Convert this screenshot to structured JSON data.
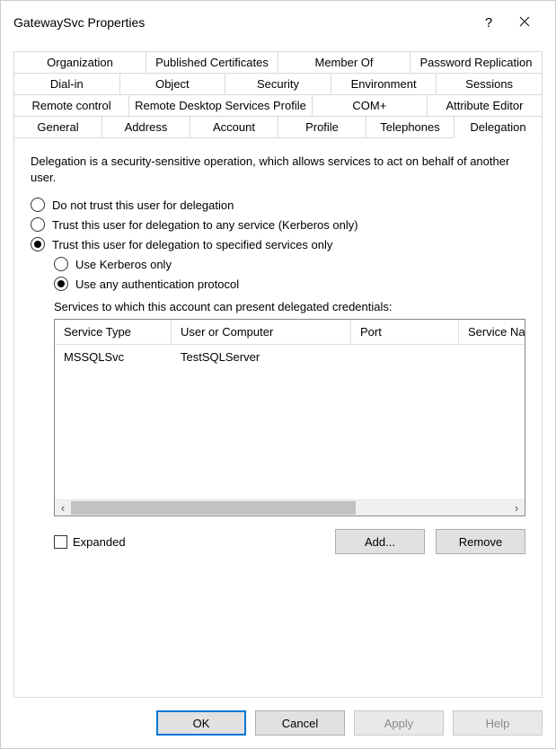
{
  "titlebar": {
    "title": "GatewaySvc Properties"
  },
  "tabs": {
    "row1": [
      "Organization",
      "Published Certificates",
      "Member Of",
      "Password Replication"
    ],
    "row2": [
      "Dial-in",
      "Object",
      "Security",
      "Environment",
      "Sessions"
    ],
    "row3": [
      "Remote control",
      "Remote Desktop Services Profile",
      "COM+",
      "Attribute Editor"
    ],
    "row4": [
      "General",
      "Address",
      "Account",
      "Profile",
      "Telephones",
      "Delegation"
    ]
  },
  "panel": {
    "description": "Delegation is a security-sensitive operation, which allows services to act on behalf of another user.",
    "radios": {
      "dontTrust": "Do not trust this user for delegation",
      "trustAny": "Trust this user for delegation to any service (Kerberos only)",
      "trustSpecified": "Trust this user for delegation to specified services only",
      "kerberosOnly": "Use Kerberos only",
      "anyProtocol": "Use any authentication protocol"
    },
    "listLabel": "Services to which this account can present delegated credentials:",
    "columns": {
      "c1": "Service Type",
      "c2": "User or Computer",
      "c3": "Port",
      "c4": "Service Na"
    },
    "rows": [
      {
        "serviceType": "MSSQLSvc",
        "userOrComputer": "TestSQLServer",
        "port": "",
        "serviceName": ""
      }
    ],
    "expanded": "Expanded",
    "add": "Add...",
    "remove": "Remove"
  },
  "footer": {
    "ok": "OK",
    "cancel": "Cancel",
    "apply": "Apply",
    "help": "Help"
  }
}
